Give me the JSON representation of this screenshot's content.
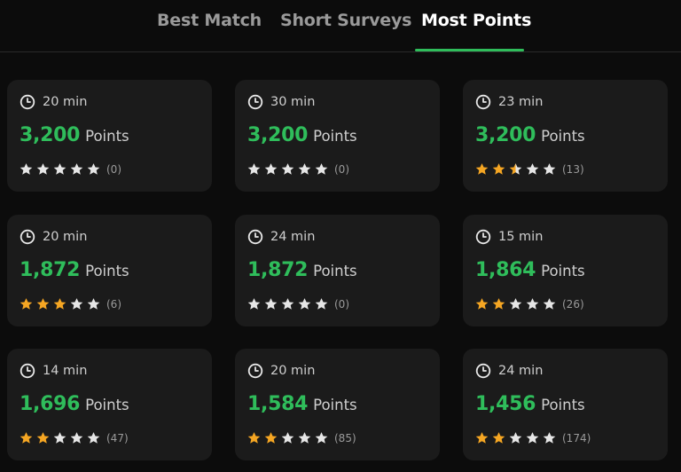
{
  "tabs": [
    {
      "label": "Best Match",
      "active": false
    },
    {
      "label": "Short Surveys",
      "active": false
    },
    {
      "label": "Most Points",
      "active": true
    }
  ],
  "colors": {
    "accent": "#2fbd5b",
    "star_filled": "#f5a623",
    "star_empty": "#e6e6e6",
    "card_bg": "#1b1b1b",
    "page_bg": "#0c0c0c"
  },
  "points_label": "Points",
  "surveys": [
    {
      "duration": "20 min",
      "points": "3,200",
      "rating": 0,
      "reviews": "(0)"
    },
    {
      "duration": "30 min",
      "points": "3,200",
      "rating": 0,
      "reviews": "(0)"
    },
    {
      "duration": "23 min",
      "points": "3,200",
      "rating": 2.5,
      "reviews": "(13)"
    },
    {
      "duration": "20 min",
      "points": "1,872",
      "rating": 3,
      "reviews": "(6)"
    },
    {
      "duration": "24 min",
      "points": "1,872",
      "rating": 0,
      "reviews": "(0)"
    },
    {
      "duration": "15 min",
      "points": "1,864",
      "rating": 2,
      "reviews": "(26)"
    },
    {
      "duration": "14 min",
      "points": "1,696",
      "rating": 2,
      "reviews": "(47)"
    },
    {
      "duration": "20 min",
      "points": "1,584",
      "rating": 2,
      "reviews": "(85)"
    },
    {
      "duration": "24 min",
      "points": "1,456",
      "rating": 2,
      "reviews": "(174)"
    }
  ]
}
